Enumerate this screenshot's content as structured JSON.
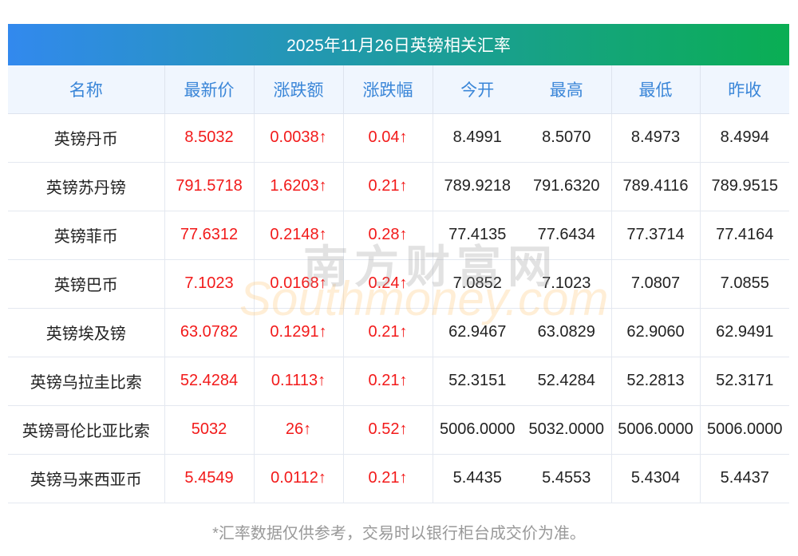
{
  "title": "2025年11月26日英镑相关汇率",
  "headers": [
    "名称",
    "最新价",
    "涨跌额",
    "涨跌幅",
    "今开",
    "最高",
    "最低",
    "昨收"
  ],
  "rows": [
    [
      "英镑丹币",
      "8.5032",
      "0.0038↑",
      "0.04↑",
      "8.4991",
      "8.5070",
      "8.4973",
      "8.4994"
    ],
    [
      "英镑苏丹镑",
      "791.5718",
      "1.6203↑",
      "0.21↑",
      "789.9218",
      "791.6320",
      "789.4116",
      "789.9515"
    ],
    [
      "英镑菲币",
      "77.6312",
      "0.2148↑",
      "0.28↑",
      "77.4135",
      "77.6434",
      "77.3714",
      "77.4164"
    ],
    [
      "英镑巴币",
      "7.1023",
      "0.0168↑",
      "0.24↑",
      "7.0852",
      "7.1023",
      "7.0807",
      "7.0855"
    ],
    [
      "英镑埃及镑",
      "63.0782",
      "0.1291↑",
      "0.21↑",
      "62.9467",
      "63.0829",
      "62.9060",
      "62.9491"
    ],
    [
      "英镑乌拉圭比索",
      "52.4284",
      "0.1113↑",
      "0.21↑",
      "52.3151",
      "52.4284",
      "52.2813",
      "52.3171"
    ],
    [
      "英镑哥伦比亚比索",
      "5032",
      "26↑",
      "0.52↑",
      "5006.0000",
      "5032.0000",
      "5006.0000",
      "5006.0000"
    ],
    [
      "英镑马来西亚币",
      "5.4549",
      "0.0112↑",
      "0.21↑",
      "5.4435",
      "5.4553",
      "5.4304",
      "5.4437"
    ]
  ],
  "watermark": {
    "cn": "南方财富网",
    "en": "Southmoney.com"
  },
  "footer": "*汇率数据仅供参考，交易时以银行柜台成交价为准。"
}
